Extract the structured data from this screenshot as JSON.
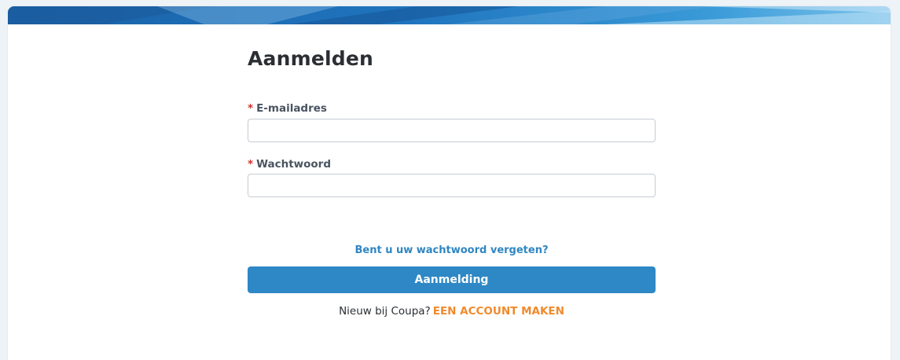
{
  "login": {
    "title": "Aanmelden",
    "email": {
      "required_marker": "*",
      "label": "E-mailadres",
      "value": "",
      "placeholder": ""
    },
    "password": {
      "required_marker": "*",
      "label": "Wachtwoord",
      "value": "",
      "placeholder": ""
    },
    "forgot_password_link": "Bent u uw wachtwoord vergeten?",
    "submit_button": "Aanmelding",
    "signup_prompt": "Nieuw bij Coupa?",
    "signup_link": "EEN ACCOUNT MAKEN"
  },
  "colors": {
    "banner_blue": "#1f6fb7",
    "button_blue": "#2e88c5",
    "link_blue": "#2f86c2",
    "signup_orange": "#f08a2c",
    "required_red": "#d0312d"
  }
}
